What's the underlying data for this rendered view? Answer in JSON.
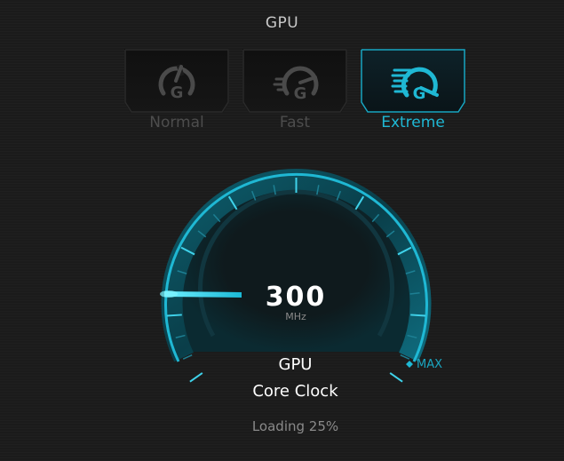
{
  "header": {
    "title": "GPU"
  },
  "modes": [
    {
      "label": "Normal",
      "icon": "gauge-normal-icon",
      "selected": false
    },
    {
      "label": "Fast",
      "icon": "gauge-fast-icon",
      "selected": false
    },
    {
      "label": "Extreme",
      "icon": "gauge-extreme-icon",
      "selected": true
    }
  ],
  "gauge": {
    "value": "300",
    "unit": "MHz",
    "max_label": "MAX",
    "level_fraction": 0.0
  },
  "caption": {
    "line1": "GPU",
    "line2": "Core Clock"
  },
  "status": {
    "loading": "Loading 25%"
  },
  "colors": {
    "accent": "#1fb8d4",
    "inactive_text": "#4d4d4d",
    "background": "#1b1b1b"
  }
}
